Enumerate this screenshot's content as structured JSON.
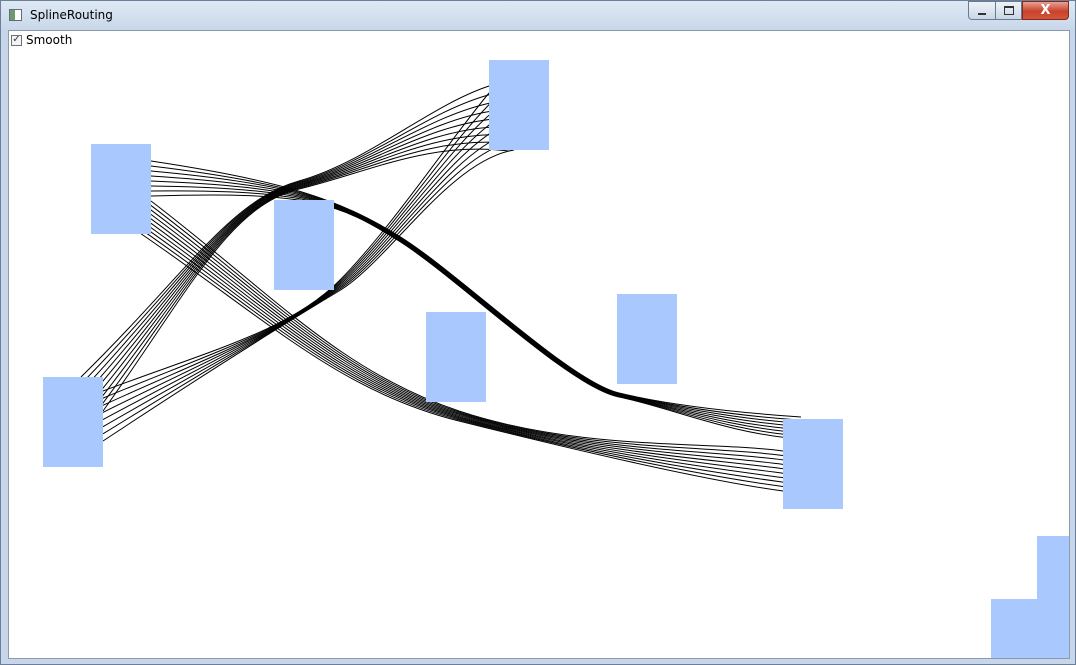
{
  "window": {
    "title": "SplineRouting",
    "close_glyph": "X",
    "check_glyph": "✓"
  },
  "controls": {
    "smooth_label": "Smooth",
    "smooth_checked": true
  },
  "colors": {
    "node_fill": "#a9c8fd",
    "edge_stroke": "#000000",
    "canvas_background": "#ffffff"
  }
}
